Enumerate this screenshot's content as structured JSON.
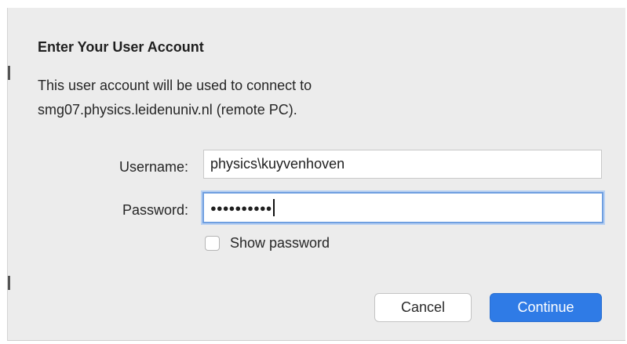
{
  "dialog": {
    "title": "Enter Your User Account",
    "description_line1": "This user account will be used to connect to",
    "description_line2": "smg07.physics.leidenuniv.nl (remote PC).",
    "username": {
      "label": "Username:",
      "value": "physics\\kuyvenhoven"
    },
    "password": {
      "label": "Password:",
      "masked_value": "●●●●●●●●●●"
    },
    "show_password": {
      "label": "Show password",
      "checked": false
    },
    "buttons": {
      "cancel": "Cancel",
      "continue": "Continue"
    }
  },
  "colors": {
    "background": "#ececec",
    "accent": "#2f7be6",
    "focus_ring": "#6f9fe0"
  }
}
